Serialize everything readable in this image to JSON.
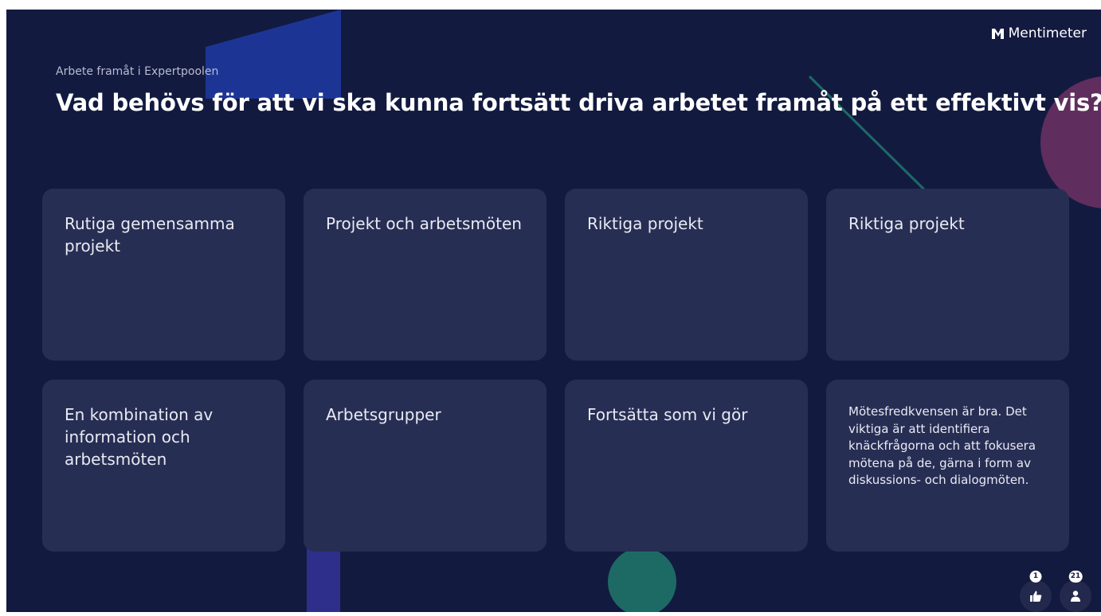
{
  "brand": {
    "name": "Mentimeter",
    "icon": "mentimeter-logo-icon"
  },
  "header": {
    "subtitle": "Arbete framåt i Expertpoolen",
    "question": "Vad behövs för att vi ska kunna fortsätt driva arbetet framåt på ett effektivt vis?"
  },
  "responses": [
    {
      "text": "Rutiga gemensamma projekt"
    },
    {
      "text": "Projekt och arbetsmöten"
    },
    {
      "text": "Riktiga projekt"
    },
    {
      "text": "Riktiga projekt"
    },
    {
      "text": "En kombination av information och arbetsmöten"
    },
    {
      "text": "Arbetsgrupper"
    },
    {
      "text": "Fortsätta som vi gör"
    },
    {
      "text": "Mötesfredkvensen är bra. Det viktiga är att identifiera knäckfrågorna och att fokusera mötena på de, gärna i form av diskussions- och dialogmöten."
    }
  ],
  "stats": {
    "reactions": {
      "count": "1",
      "icon": "thumbs-up-icon"
    },
    "participants": {
      "count": "21",
      "icon": "person-icon"
    }
  },
  "colors": {
    "background": "#131a40",
    "card": "#272e54",
    "accent_blue": "#1c3595",
    "accent_purple": "#2e2f8a",
    "accent_teal": "#1d6a65",
    "accent_pink": "#5f2e5e"
  }
}
